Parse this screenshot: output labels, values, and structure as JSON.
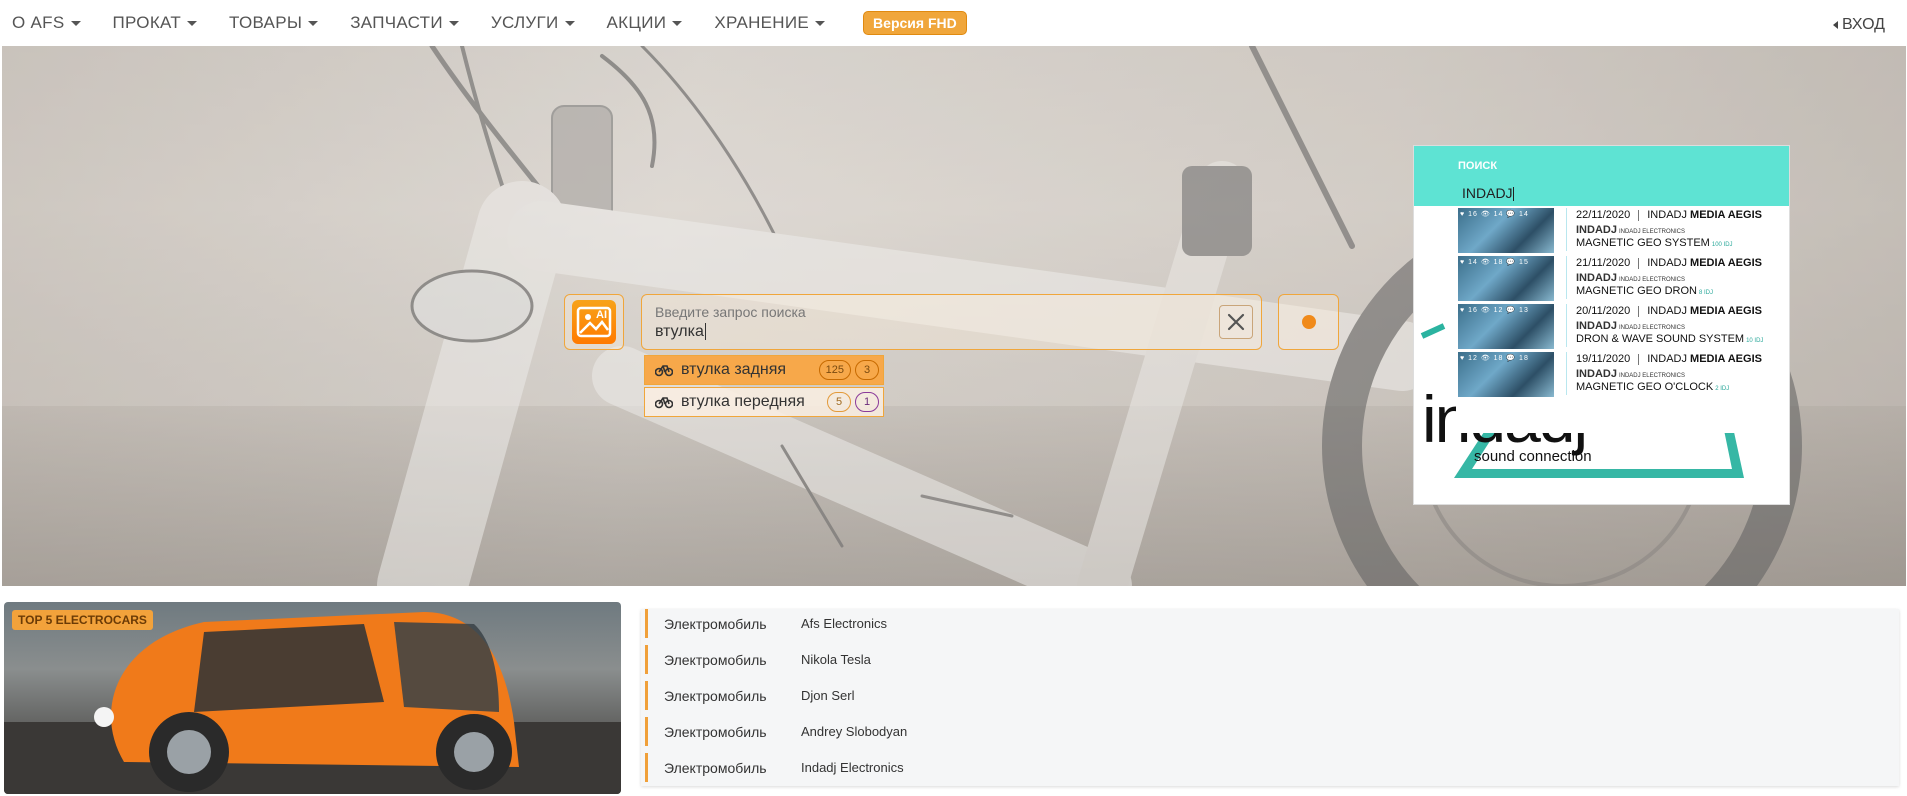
{
  "nav": {
    "items": [
      "О AFS",
      "ПРОКАТ",
      "ТОВАРЫ",
      "ЗАПЧАСТИ",
      "УСЛУГИ",
      "АКЦИИ",
      "ХРАНЕНИЕ"
    ],
    "version_badge": "Версия FHD",
    "login": "ВХОД"
  },
  "search": {
    "placeholder": "Введите запрос поиска",
    "value": "втулка",
    "suggestions": [
      {
        "label": "втулка задняя",
        "count1": "125",
        "count2": "3"
      },
      {
        "label": "втулка передняя",
        "count1": "5",
        "count2": "1"
      }
    ]
  },
  "widget": {
    "label": "ПОИСК",
    "input_value": "INDADJ",
    "logo_text": "indadj",
    "tagline": "sound connection",
    "results": [
      {
        "stats": "♥ 16 👁 14 💬 14",
        "date": "22/11/2020",
        "channel_prefix": "INDADJ",
        "channel": "MEDIA AEGIS",
        "brand": "INDADJ",
        "brand_sub": "INDADJ ELECTRONICS",
        "title": "MAGNETIC GEO SYSTEM",
        "title_sub": "100 IDJ"
      },
      {
        "stats": "♥ 14 👁 18 💬 15",
        "date": "21/11/2020",
        "channel_prefix": "INDADJ",
        "channel": "MEDIA AEGIS",
        "brand": "INDADJ",
        "brand_sub": "INDADJ ELECTRONICS",
        "title": "MAGNETIC GEO DRON",
        "title_sub": "8 IDJ"
      },
      {
        "stats": "♥ 16 👁 12 💬 13",
        "date": "20/11/2020",
        "channel_prefix": "INDADJ",
        "channel": "MEDIA AEGIS",
        "brand": "INDADJ",
        "brand_sub": "INDADJ ELECTRONICS",
        "title": "DRON & WAVE SOUND SYSTEM",
        "title_sub": "10 IDJ"
      },
      {
        "stats": "♥ 12 👁 18 💬 18",
        "date": "19/11/2020",
        "channel_prefix": "INDADJ",
        "channel": "MEDIA AEGIS",
        "brand": "INDADJ",
        "brand_sub": "INDADJ ELECTRONICS",
        "title": "MAGNETIC GEO O'CLOCK",
        "title_sub": "2 IDJ"
      }
    ]
  },
  "promo": {
    "badge": "TOP 5 ELECTROCARS"
  },
  "cars": [
    {
      "type": "Электромобиль",
      "name": "Afs Electronics"
    },
    {
      "type": "Электромобиль",
      "name": "Nikola Tesla"
    },
    {
      "type": "Электромобиль",
      "name": "Djon Serl"
    },
    {
      "type": "Электромобиль",
      "name": "Andrey Slobodyan"
    },
    {
      "type": "Электромобиль",
      "name": "Indadj Electronics"
    }
  ],
  "colors": {
    "accent": "#f0a63b",
    "widget_header": "#5ee3d3",
    "car_bar": "#f0a03a"
  }
}
